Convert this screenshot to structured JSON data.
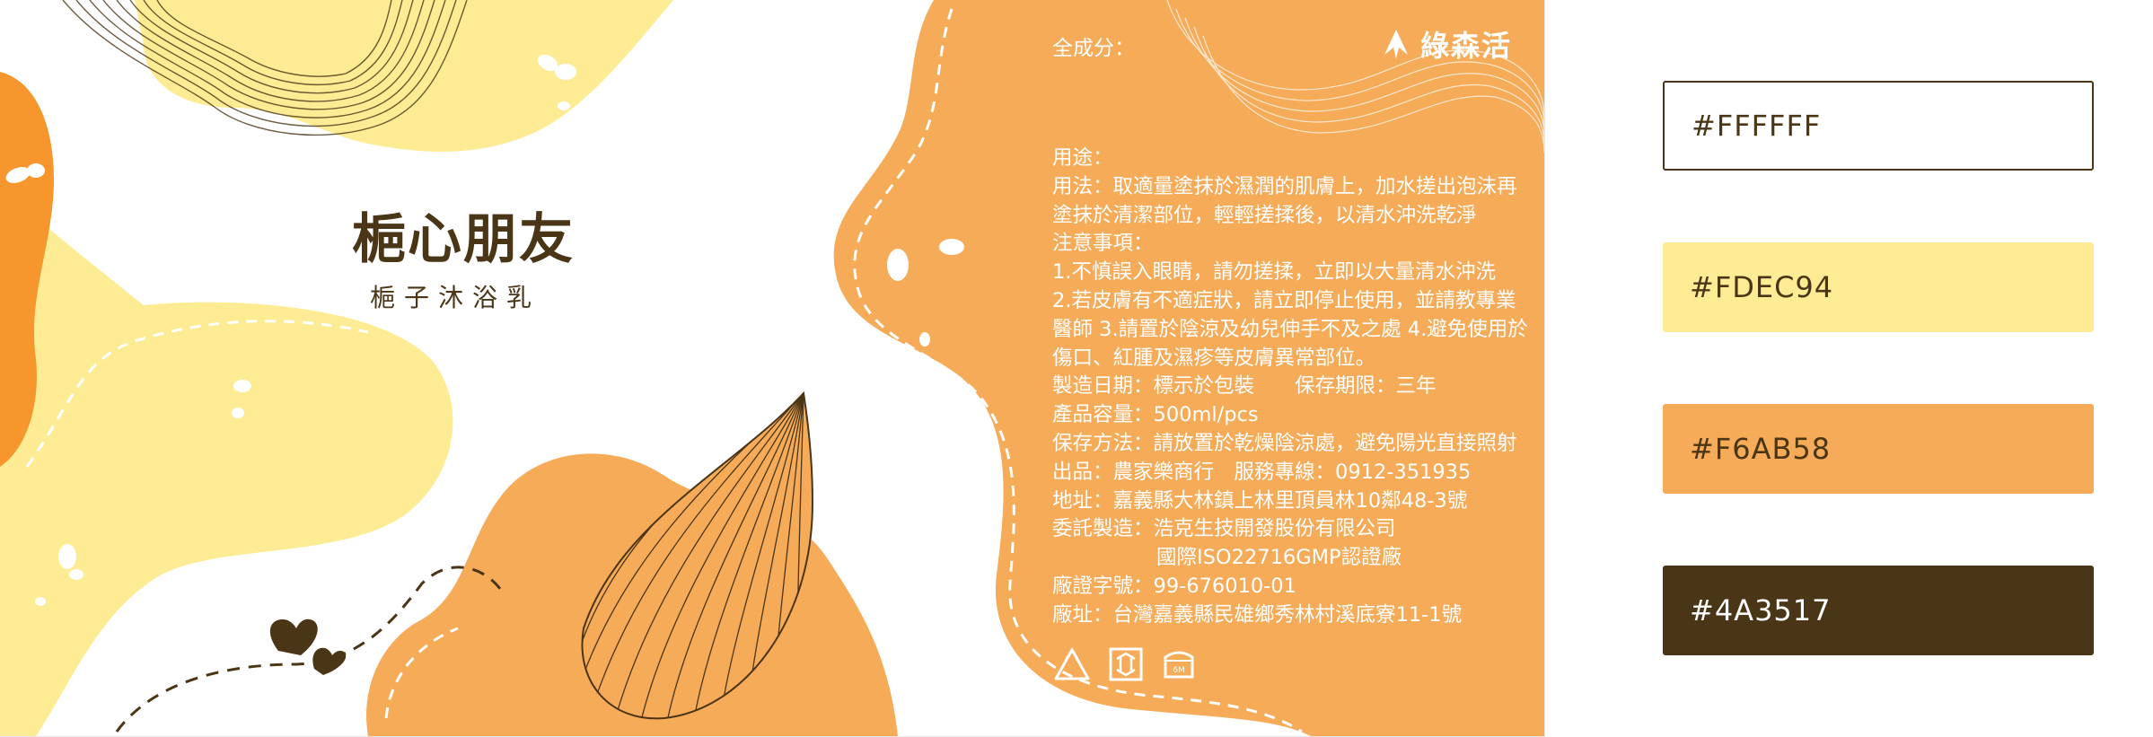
{
  "label": {
    "brand_title": "梔心朋友",
    "brand_subtitle": "梔子沐浴乳",
    "ingredients_label": "全成分：",
    "logo_text": "綠森活",
    "info_lines": [
      "用途：",
      "用法：取適量塗抹於濕潤的肌膚上，加水搓出泡沫再",
      "塗抹於清潔部位，輕輕搓揉後，以清水沖洗乾淨",
      "注意事項：",
      "1.不慎誤入眼睛，請勿搓揉，立即以大量清水沖洗",
      "2.若皮膚有不適症狀，請立即停止使用，並請教專業",
      "醫師 3.請置於陰涼及幼兒伸手不及之處 4.避免使用於",
      "傷口、紅腫及濕疹等皮膚異常部位。",
      "製造日期：標示於包裝　　保存期限：三年",
      "產品容量：500ml/pcs",
      "保存方法：請放置於乾燥陰涼處，避免陽光直接照射",
      "出品：農家樂商行　服務專線：0912-351935",
      "地址：嘉義縣大林鎮上林里頂員林10鄰48-3號",
      "委託製造：浩克生技開發股份有限公司",
      "國際ISO22716GMP認證廠",
      "廠證字號：99-676010-01",
      "廠址：台灣嘉義縣民雄鄉秀林村溪底寮11-1號"
    ],
    "symbol_icons": [
      "recycle-icon",
      "recycle-box-icon",
      "jar-6m-icon"
    ],
    "jar_icon_text": "6M"
  },
  "palette": [
    {
      "hex": "#FFFFFF",
      "text_color": "#4A3517",
      "border": "#4A3517"
    },
    {
      "hex": "#FDEC94",
      "text_color": "#4A3517",
      "border": "none"
    },
    {
      "hex": "#F6AB58",
      "text_color": "#4A3517",
      "border": "none"
    },
    {
      "hex": "#4A3517",
      "text_color": "#ffffff",
      "border": "none"
    }
  ]
}
